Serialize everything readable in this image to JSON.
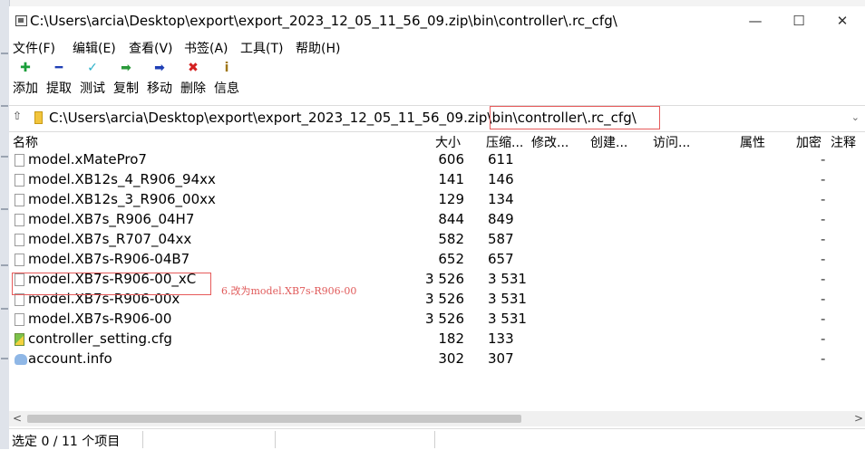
{
  "window": {
    "title": "C:\\Users\\arcia\\Desktop\\export\\export_2023_12_05_11_56_09.zip\\bin\\controller\\.rc_cfg\\",
    "minimize_glyph": "—",
    "maximize_glyph": "☐",
    "close_glyph": "✕"
  },
  "menu": [
    "文件(F)",
    "编辑(E)",
    "查看(V)",
    "书签(A)",
    "工具(T)",
    "帮助(H)"
  ],
  "toolbar": [
    {
      "label": "添加",
      "icon": "add-icon",
      "glyph": "✚",
      "color": "#1a9e3a"
    },
    {
      "label": "提取",
      "icon": "extract-icon",
      "glyph": "━",
      "color": "#1f3fb5"
    },
    {
      "label": "测试",
      "icon": "test-icon",
      "glyph": "✓",
      "color": "#2ab0c8"
    },
    {
      "label": "复制",
      "icon": "copy-icon",
      "glyph": "➡",
      "color": "#2a9a3a"
    },
    {
      "label": "移动",
      "icon": "move-icon",
      "glyph": "➡",
      "color": "#1f3fb5"
    },
    {
      "label": "删除",
      "icon": "delete-icon",
      "glyph": "✖",
      "color": "#d42020"
    },
    {
      "label": "信息",
      "icon": "info-icon",
      "glyph": "i",
      "color": "#a0781a"
    }
  ],
  "address": {
    "path": "C:\\Users\\arcia\\Desktop\\export\\export_2023_12_05_11_56_09.zip\\bin\\controller\\.rc_cfg\\",
    "up_glyph": "⇧"
  },
  "columns": {
    "name": "名称",
    "size": "大小",
    "packed": "压缩...",
    "modified": "修改...",
    "created": "创建...",
    "accessed": "访问...",
    "attributes": "属性",
    "encrypted": "加密",
    "comment": "注释"
  },
  "files": [
    {
      "name": "model.xMatePro7",
      "size": "606",
      "packed": "611",
      "encrypted": "-",
      "icon": "file-icon"
    },
    {
      "name": "model.XB12s_4_R906_94xx",
      "size": "141",
      "packed": "146",
      "encrypted": "-",
      "icon": "file-icon"
    },
    {
      "name": "model.XB12s_3_R906_00xx",
      "size": "129",
      "packed": "134",
      "encrypted": "-",
      "icon": "file-icon"
    },
    {
      "name": "model.XB7s_R906_04H7",
      "size": "844",
      "packed": "849",
      "encrypted": "-",
      "icon": "file-icon"
    },
    {
      "name": "model.XB7s_R707_04xx",
      "size": "582",
      "packed": "587",
      "encrypted": "-",
      "icon": "file-icon"
    },
    {
      "name": "model.XB7s-R906-04B7",
      "size": "652",
      "packed": "657",
      "encrypted": "-",
      "icon": "file-icon"
    },
    {
      "name": "model.XB7s-R906-00_xC",
      "size": "3 526",
      "packed": "3 531",
      "encrypted": "-",
      "icon": "file-icon"
    },
    {
      "name": "model.XB7s-R906-00x",
      "size": "3 526",
      "packed": "3 531",
      "encrypted": "-",
      "icon": "file-icon"
    },
    {
      "name": "model.XB7s-R906-00",
      "size": "3 526",
      "packed": "3 531",
      "encrypted": "-",
      "icon": "file-icon"
    },
    {
      "name": "controller_setting.cfg",
      "size": "182",
      "packed": "133",
      "encrypted": "-",
      "icon": "config-file-icon"
    },
    {
      "name": "account.info",
      "size": "302",
      "packed": "307",
      "encrypted": "-",
      "icon": "info-file-icon"
    }
  ],
  "annotation": "6.改为model.XB7s-R906-00",
  "annotation_color": "#e05a5a",
  "scroll": {
    "left_glyph": "<",
    "right_glyph": ">"
  },
  "status": "选定 0 / 11 个项目"
}
